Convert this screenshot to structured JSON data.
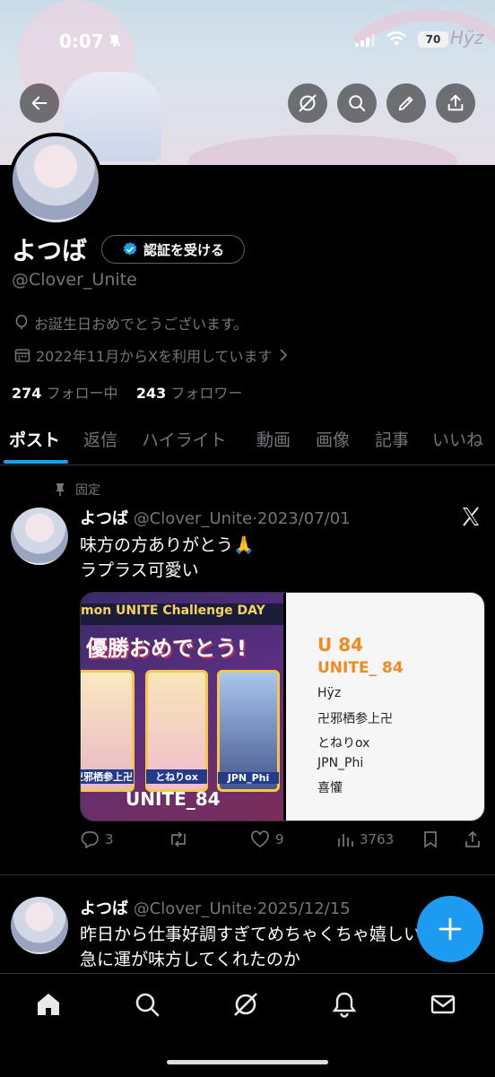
{
  "status_bar": {
    "time": "0:07",
    "battery": "70"
  },
  "banner": {
    "watermark": "Hÿz"
  },
  "profile": {
    "name": "よつば",
    "verify_label": "認証を受ける",
    "handle": "@Clover_Unite",
    "bio": "お誕生日おめでとうございます。",
    "joined": "2022年11月からXを利用しています",
    "following_count": "274",
    "following_label": "フォロー中",
    "followers_count": "243",
    "followers_label": "フォロワー"
  },
  "tabs": [
    "ポスト",
    "返信",
    "ハイライト",
    "動画",
    "画像",
    "記事",
    "いいね"
  ],
  "pinned_label": "固定",
  "posts": [
    {
      "name": "よつば",
      "handle": "@Clover_Unite",
      "date": "2023/07/01",
      "lines": [
        "味方の方ありがとう🙏",
        "ラプラス可愛い"
      ],
      "media": {
        "banner_text": "mon UNITE Challenge DAY",
        "title": "優勝おめでとう!",
        "card_labels": [
          "卍邪栖参上卍",
          "とねりox",
          "JPN_Phi"
        ],
        "team": "UNITE_84",
        "right_title1": "U 84",
        "right_title2": "UNITE_ 84",
        "members": [
          "Hÿz",
          "卍邪栖参上卍",
          "とねりox",
          "JPN_Phi",
          "喜懽"
        ]
      },
      "replies": "3",
      "reposts": "",
      "likes": "9",
      "views": "3763"
    },
    {
      "name": "よつば",
      "handle": "@Clover_Unite",
      "date": "2025/12/15",
      "lines": [
        "昨日から仕事好調すぎてめちゃくちゃ嬉しい",
        "急に運が味方してくれたのか"
      ]
    }
  ],
  "icons": {
    "back": "arrow-left-icon",
    "grok": "grok-icon",
    "search": "search-icon",
    "edit": "pen-icon",
    "share": "share-icon",
    "compose": "plus-icon",
    "home": "home-icon",
    "notifications": "bell-icon",
    "messages": "mail-icon"
  },
  "colors": {
    "accent": "#1d9bf0",
    "background": "#000000",
    "muted": "#71767b"
  }
}
